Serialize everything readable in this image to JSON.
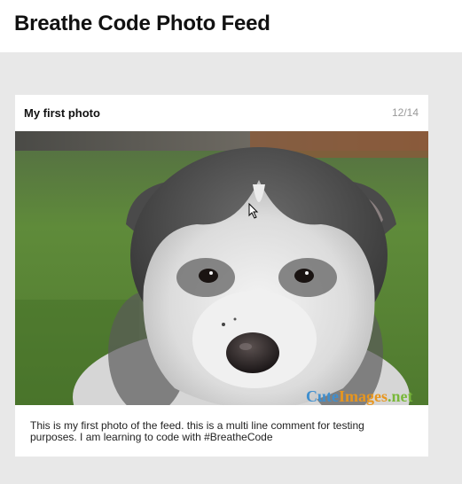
{
  "app": {
    "title": "Breathe Code Photo Feed"
  },
  "posts": [
    {
      "title": "My first photo",
      "counter": "12/14",
      "caption_text": "This is my first photo of the feed. this is a multi line comment for testing purposes. I am learning to code with ",
      "hashtag": "#BreatheCode",
      "image_watermark": {
        "part1": "Cute",
        "part2": "Images",
        "part3": ".net"
      }
    }
  ],
  "colors": {
    "feed_background": "#e8e8e8",
    "card_background": "#ffffff",
    "counter_text": "#999999"
  }
}
